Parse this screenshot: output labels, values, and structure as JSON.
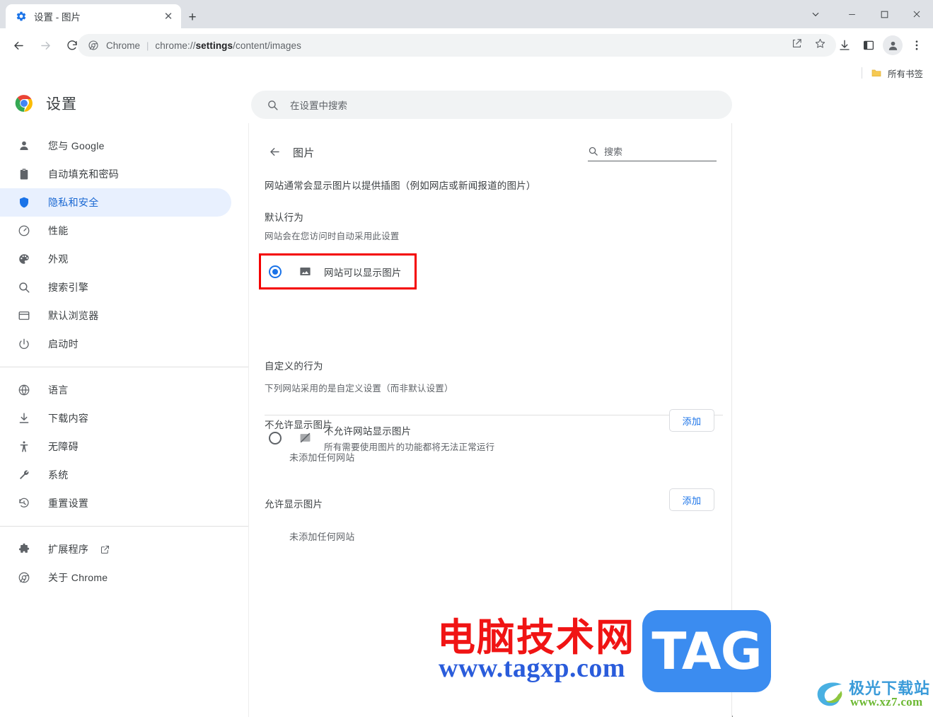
{
  "window": {
    "controls": {
      "chevron": "chevron-down",
      "minimize": "—",
      "maximize": "▢",
      "close": "✕"
    }
  },
  "tab": {
    "favicon": "gear-icon",
    "title": "设置 - 图片",
    "close_label": "✕",
    "newtab_label": "+"
  },
  "toolbar": {
    "back": "back-arrow-icon",
    "forward": "forward-arrow-icon",
    "reload": "reload-icon",
    "omnibox": {
      "site_icon": "chrome-icon",
      "scheme_label": "Chrome",
      "separator": "|",
      "url_prefix": "chrome://",
      "url_bold": "settings",
      "url_suffix": "/content/images"
    },
    "share_icon": "share-icon",
    "bookmark_icon": "star-icon",
    "download_icon": "download-icon",
    "sidepanel_icon": "side-panel-icon",
    "profile_icon": "profile-avatar-icon",
    "menu_icon": "three-dot-menu-icon"
  },
  "bookmarks_bar": {
    "folder_icon": "folder-icon",
    "all_bookmarks_label": "所有书签"
  },
  "settings_header": {
    "logo": "chrome-logo",
    "title": "设置",
    "search_icon": "search-icon",
    "search_placeholder": "在设置中搜索",
    "search_value": ""
  },
  "sidebar": {
    "items": [
      {
        "label": "您与 Google",
        "icon": "person-icon",
        "active": false
      },
      {
        "label": "自动填充和密码",
        "icon": "clipboard-icon",
        "active": false
      },
      {
        "label": "隐私和安全",
        "icon": "shield-icon",
        "active": true
      },
      {
        "label": "性能",
        "icon": "speedometer-icon",
        "active": false
      },
      {
        "label": "外观",
        "icon": "palette-icon",
        "active": false
      },
      {
        "label": "搜索引擎",
        "icon": "search-icon",
        "active": false
      },
      {
        "label": "默认浏览器",
        "icon": "browser-window-icon",
        "active": false
      },
      {
        "label": "启动时",
        "icon": "power-icon",
        "active": false
      },
      {
        "label": "语言",
        "icon": "globe-icon",
        "active": false
      },
      {
        "label": "下载内容",
        "icon": "download-icon",
        "active": false
      },
      {
        "label": "无障碍",
        "icon": "accessibility-icon",
        "active": false
      },
      {
        "label": "系统",
        "icon": "wrench-icon",
        "active": false
      },
      {
        "label": "重置设置",
        "icon": "history-restore-icon",
        "active": false
      },
      {
        "label": "扩展程序",
        "icon": "puzzle-icon",
        "active": false,
        "external": "external-link-icon"
      },
      {
        "label": "关于 Chrome",
        "icon": "chrome-icon",
        "active": false
      }
    ]
  },
  "content": {
    "back_icon": "back-arrow-icon",
    "title": "图片",
    "search_icon": "search-icon",
    "search_placeholder": "搜索",
    "search_value": "",
    "description": "网站通常会显示图片以提供插图（例如网店或新闻报道的图片）",
    "default_behavior": {
      "title": "默认行为",
      "subtitle": "网站会在您访问时自动采用此设置",
      "options": [
        {
          "label": "网站可以显示图片",
          "sublabel": "",
          "icon": "image-icon",
          "selected": true,
          "highlighted": true
        },
        {
          "label": "不允许网站显示图片",
          "sublabel": "所有需要使用图片的功能都将无法正常运行",
          "icon": "image-blocked-icon",
          "selected": false,
          "highlighted": false
        }
      ]
    },
    "custom_behavior": {
      "title": "自定义的行为",
      "subtitle": "下列网站采用的是自定义设置（而非默认设置）",
      "groups": [
        {
          "label": "不允许显示图片",
          "add_label": "添加",
          "empty_label": "未添加任何网站"
        },
        {
          "label": "允许显示图片",
          "add_label": "添加",
          "empty_label": "未添加任何网站"
        }
      ]
    }
  },
  "watermarks": {
    "main": {
      "cn_text": "电脑技术网",
      "url_text": "www.tagxp.com",
      "badge_text": "TAG",
      "cn_color": "#f01414",
      "url_color": "#2a5cdb",
      "badge_color": "#3b8cf0"
    },
    "corner": {
      "cn_text": "极光下载站",
      "url_text": "www.xz7.com",
      "cn_color": "#3a9bd9",
      "url_color": "#6cb832"
    }
  },
  "colors": {
    "accent": "#1a73e8",
    "active_pill": "#e8f0fe",
    "highlight_box": "#f40000",
    "tabstrip": "#dee1e6"
  }
}
